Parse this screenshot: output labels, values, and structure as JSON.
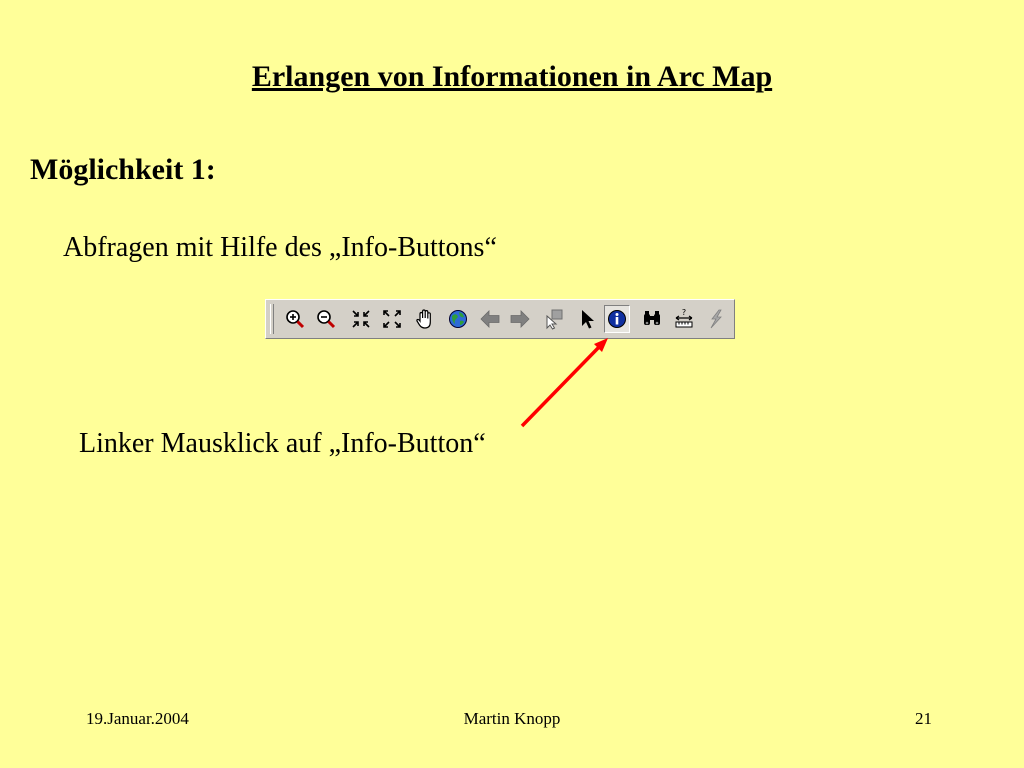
{
  "slide": {
    "title": "Erlangen von Informationen in Arc Map",
    "subtitle": "Möglichkeit 1:",
    "line1": "Abfragen mit Hilfe des „Info-Buttons“",
    "line2": "Linker Mausklick auf „Info-Button“"
  },
  "toolbar": {
    "buttons": [
      {
        "icon": "zoom-in-icon",
        "pressed": false
      },
      {
        "icon": "zoom-out-icon",
        "pressed": false
      },
      {
        "icon": "fixed-zoom-in-icon",
        "pressed": false
      },
      {
        "icon": "fixed-zoom-out-icon",
        "pressed": false
      },
      {
        "icon": "pan-hand-icon",
        "pressed": false
      },
      {
        "icon": "full-extent-globe-icon",
        "pressed": false
      },
      {
        "icon": "back-arrow-icon",
        "pressed": false
      },
      {
        "icon": "forward-arrow-icon",
        "pressed": false
      },
      {
        "icon": "select-features-icon",
        "pressed": false
      },
      {
        "icon": "select-elements-pointer-icon",
        "pressed": false
      },
      {
        "icon": "identify-info-icon",
        "pressed": true
      },
      {
        "icon": "find-binoculars-icon",
        "pressed": false
      },
      {
        "icon": "measure-icon",
        "pressed": false
      },
      {
        "icon": "hyperlink-lightning-icon",
        "pressed": false
      }
    ]
  },
  "colors": {
    "background": "#FFFF99",
    "arrow": "#FF0000",
    "toolbar": "#D4D0C8"
  },
  "footer": {
    "date": "19.Januar.2004",
    "author": "Martin Knopp",
    "page_number": "21"
  }
}
